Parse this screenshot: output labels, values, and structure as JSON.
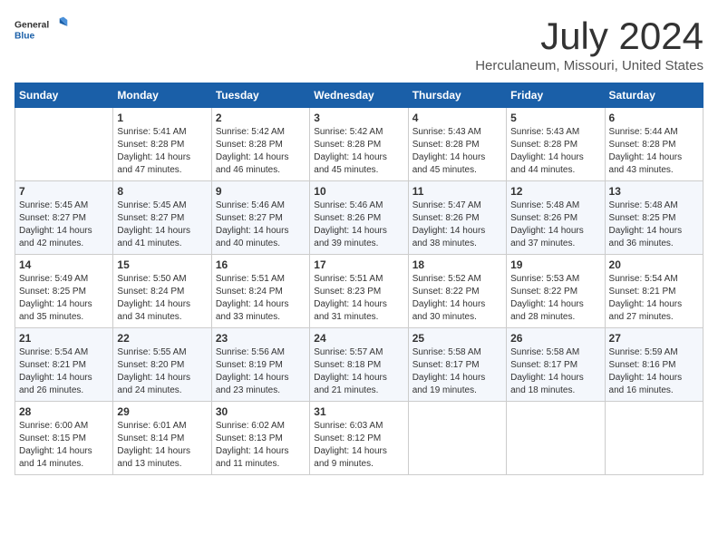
{
  "header": {
    "logo_general": "General",
    "logo_blue": "Blue",
    "month": "July 2024",
    "location": "Herculaneum, Missouri, United States"
  },
  "weekdays": [
    "Sunday",
    "Monday",
    "Tuesday",
    "Wednesday",
    "Thursday",
    "Friday",
    "Saturday"
  ],
  "weeks": [
    [
      {
        "day": "",
        "sunrise": "",
        "sunset": "",
        "daylight": ""
      },
      {
        "day": "1",
        "sunrise": "Sunrise: 5:41 AM",
        "sunset": "Sunset: 8:28 PM",
        "daylight": "Daylight: 14 hours and 47 minutes."
      },
      {
        "day": "2",
        "sunrise": "Sunrise: 5:42 AM",
        "sunset": "Sunset: 8:28 PM",
        "daylight": "Daylight: 14 hours and 46 minutes."
      },
      {
        "day": "3",
        "sunrise": "Sunrise: 5:42 AM",
        "sunset": "Sunset: 8:28 PM",
        "daylight": "Daylight: 14 hours and 45 minutes."
      },
      {
        "day": "4",
        "sunrise": "Sunrise: 5:43 AM",
        "sunset": "Sunset: 8:28 PM",
        "daylight": "Daylight: 14 hours and 45 minutes."
      },
      {
        "day": "5",
        "sunrise": "Sunrise: 5:43 AM",
        "sunset": "Sunset: 8:28 PM",
        "daylight": "Daylight: 14 hours and 44 minutes."
      },
      {
        "day": "6",
        "sunrise": "Sunrise: 5:44 AM",
        "sunset": "Sunset: 8:28 PM",
        "daylight": "Daylight: 14 hours and 43 minutes."
      }
    ],
    [
      {
        "day": "7",
        "sunrise": "Sunrise: 5:45 AM",
        "sunset": "Sunset: 8:27 PM",
        "daylight": "Daylight: 14 hours and 42 minutes."
      },
      {
        "day": "8",
        "sunrise": "Sunrise: 5:45 AM",
        "sunset": "Sunset: 8:27 PM",
        "daylight": "Daylight: 14 hours and 41 minutes."
      },
      {
        "day": "9",
        "sunrise": "Sunrise: 5:46 AM",
        "sunset": "Sunset: 8:27 PM",
        "daylight": "Daylight: 14 hours and 40 minutes."
      },
      {
        "day": "10",
        "sunrise": "Sunrise: 5:46 AM",
        "sunset": "Sunset: 8:26 PM",
        "daylight": "Daylight: 14 hours and 39 minutes."
      },
      {
        "day": "11",
        "sunrise": "Sunrise: 5:47 AM",
        "sunset": "Sunset: 8:26 PM",
        "daylight": "Daylight: 14 hours and 38 minutes."
      },
      {
        "day": "12",
        "sunrise": "Sunrise: 5:48 AM",
        "sunset": "Sunset: 8:26 PM",
        "daylight": "Daylight: 14 hours and 37 minutes."
      },
      {
        "day": "13",
        "sunrise": "Sunrise: 5:48 AM",
        "sunset": "Sunset: 8:25 PM",
        "daylight": "Daylight: 14 hours and 36 minutes."
      }
    ],
    [
      {
        "day": "14",
        "sunrise": "Sunrise: 5:49 AM",
        "sunset": "Sunset: 8:25 PM",
        "daylight": "Daylight: 14 hours and 35 minutes."
      },
      {
        "day": "15",
        "sunrise": "Sunrise: 5:50 AM",
        "sunset": "Sunset: 8:24 PM",
        "daylight": "Daylight: 14 hours and 34 minutes."
      },
      {
        "day": "16",
        "sunrise": "Sunrise: 5:51 AM",
        "sunset": "Sunset: 8:24 PM",
        "daylight": "Daylight: 14 hours and 33 minutes."
      },
      {
        "day": "17",
        "sunrise": "Sunrise: 5:51 AM",
        "sunset": "Sunset: 8:23 PM",
        "daylight": "Daylight: 14 hours and 31 minutes."
      },
      {
        "day": "18",
        "sunrise": "Sunrise: 5:52 AM",
        "sunset": "Sunset: 8:22 PM",
        "daylight": "Daylight: 14 hours and 30 minutes."
      },
      {
        "day": "19",
        "sunrise": "Sunrise: 5:53 AM",
        "sunset": "Sunset: 8:22 PM",
        "daylight": "Daylight: 14 hours and 28 minutes."
      },
      {
        "day": "20",
        "sunrise": "Sunrise: 5:54 AM",
        "sunset": "Sunset: 8:21 PM",
        "daylight": "Daylight: 14 hours and 27 minutes."
      }
    ],
    [
      {
        "day": "21",
        "sunrise": "Sunrise: 5:54 AM",
        "sunset": "Sunset: 8:21 PM",
        "daylight": "Daylight: 14 hours and 26 minutes."
      },
      {
        "day": "22",
        "sunrise": "Sunrise: 5:55 AM",
        "sunset": "Sunset: 8:20 PM",
        "daylight": "Daylight: 14 hours and 24 minutes."
      },
      {
        "day": "23",
        "sunrise": "Sunrise: 5:56 AM",
        "sunset": "Sunset: 8:19 PM",
        "daylight": "Daylight: 14 hours and 23 minutes."
      },
      {
        "day": "24",
        "sunrise": "Sunrise: 5:57 AM",
        "sunset": "Sunset: 8:18 PM",
        "daylight": "Daylight: 14 hours and 21 minutes."
      },
      {
        "day": "25",
        "sunrise": "Sunrise: 5:58 AM",
        "sunset": "Sunset: 8:17 PM",
        "daylight": "Daylight: 14 hours and 19 minutes."
      },
      {
        "day": "26",
        "sunrise": "Sunrise: 5:58 AM",
        "sunset": "Sunset: 8:17 PM",
        "daylight": "Daylight: 14 hours and 18 minutes."
      },
      {
        "day": "27",
        "sunrise": "Sunrise: 5:59 AM",
        "sunset": "Sunset: 8:16 PM",
        "daylight": "Daylight: 14 hours and 16 minutes."
      }
    ],
    [
      {
        "day": "28",
        "sunrise": "Sunrise: 6:00 AM",
        "sunset": "Sunset: 8:15 PM",
        "daylight": "Daylight: 14 hours and 14 minutes."
      },
      {
        "day": "29",
        "sunrise": "Sunrise: 6:01 AM",
        "sunset": "Sunset: 8:14 PM",
        "daylight": "Daylight: 14 hours and 13 minutes."
      },
      {
        "day": "30",
        "sunrise": "Sunrise: 6:02 AM",
        "sunset": "Sunset: 8:13 PM",
        "daylight": "Daylight: 14 hours and 11 minutes."
      },
      {
        "day": "31",
        "sunrise": "Sunrise: 6:03 AM",
        "sunset": "Sunset: 8:12 PM",
        "daylight": "Daylight: 14 hours and 9 minutes."
      },
      {
        "day": "",
        "sunrise": "",
        "sunset": "",
        "daylight": ""
      },
      {
        "day": "",
        "sunrise": "",
        "sunset": "",
        "daylight": ""
      },
      {
        "day": "",
        "sunrise": "",
        "sunset": "",
        "daylight": ""
      }
    ]
  ]
}
